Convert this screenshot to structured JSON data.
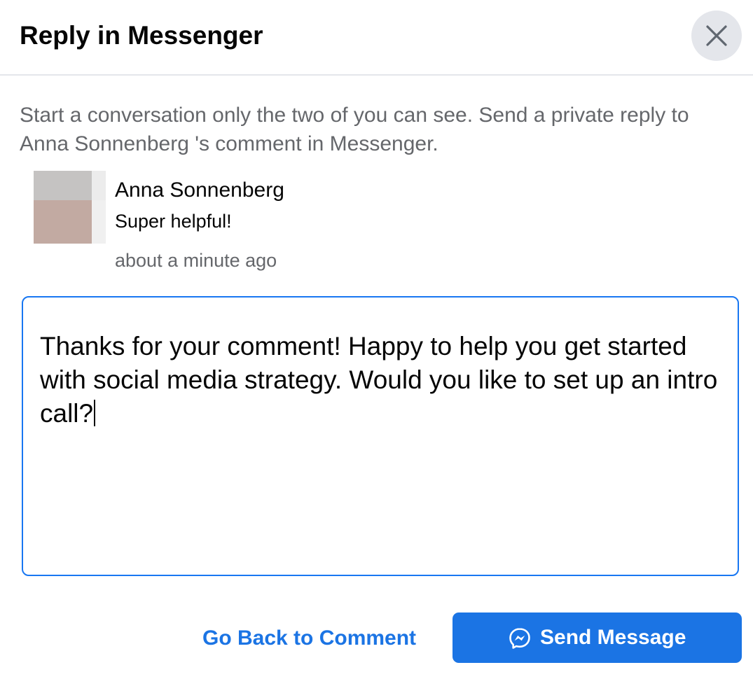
{
  "header": {
    "title": "Reply in Messenger",
    "close_icon": "close-icon"
  },
  "intro": {
    "text": "Start a conversation only the two of you can see. Send a private reply to Anna Sonnenberg 's comment in Messenger."
  },
  "comment": {
    "author": "Anna Sonnenberg",
    "text": "Super helpful!",
    "timestamp": "about a minute ago"
  },
  "reply": {
    "value": "Thanks for your comment! Happy to help you get started with social media strategy. Would you like to set up an intro call?"
  },
  "footer": {
    "back_label": "Go Back to Comment",
    "send_label": "Send Message",
    "send_icon": "messenger-icon"
  },
  "colors": {
    "accent": "#1b74e4",
    "secondary_text": "#65676b",
    "close_bg": "#e4e6eb"
  }
}
